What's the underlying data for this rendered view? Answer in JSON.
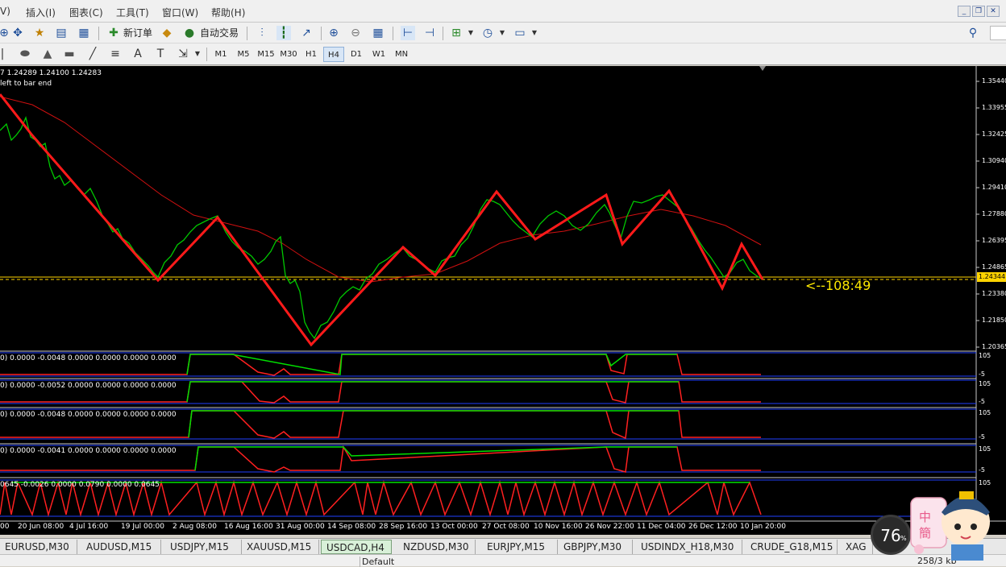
{
  "menu": {
    "items": [
      "V)",
      "插入(I)",
      "图表(C)",
      "工具(T)",
      "窗口(W)",
      "帮助(H)"
    ]
  },
  "toolbar": {
    "new_order_label": "新订单",
    "auto_trade_label": "自动交易"
  },
  "timeframes": [
    {
      "label": "M1",
      "active": false
    },
    {
      "label": "M5",
      "active": false
    },
    {
      "label": "M15",
      "active": false
    },
    {
      "label": "M30",
      "active": false
    },
    {
      "label": "H1",
      "active": false
    },
    {
      "label": "H4",
      "active": true
    },
    {
      "label": "D1",
      "active": false
    },
    {
      "label": "W1",
      "active": false
    },
    {
      "label": "MN",
      "active": false
    }
  ],
  "chart": {
    "ohlc_text": "7 1.24289 1.24100 1.24283",
    "bar_end_text": "left to bar end",
    "timer_text": "<--108:49",
    "bid_price": "1.24344",
    "price_scale": [
      "1.35440",
      "1.33955",
      "1.32425",
      "1.30940",
      "1.29410",
      "1.27880",
      "1.26395",
      "1.24865",
      "1.23380",
      "1.21850",
      "1.20365"
    ],
    "time_scale": [
      "20 Jun 08:00",
      "4 Jul 16:00",
      "19 Jul 00:00",
      "2 Aug 08:00",
      "16 Aug 16:00",
      "31 Aug 00:00",
      "14 Sep 08:00",
      "28 Sep 16:00",
      "13 Oct 00:00",
      "27 Oct 08:00",
      "10 Nov 16:00",
      "26 Nov 22:00",
      "11 Dec 04:00",
      "26 Dec 12:00",
      "10 Jan 20:00"
    ],
    "time_leading": "00",
    "indicators": [
      {
        "label": "0) 0.0000 -0.0048 0.0000 0.0000 0.0000 0.0000",
        "scale_top": "105",
        "scale_bottom": "-5"
      },
      {
        "label": "0) 0.0000 -0.0052 0.0000 0.0000 0.0000 0.0000",
        "scale_top": "105",
        "scale_bottom": "-5"
      },
      {
        "label": "0) 0.0000 -0.0048 0.0000 0.0000 0.0000 0.0000",
        "scale_top": "105",
        "scale_bottom": "-5"
      },
      {
        "label": "0) 0.0000 -0.0041 0.0000 0.0000 0.0000 0.0000",
        "scale_top": "105",
        "scale_bottom": "-5"
      },
      {
        "label": "0645 -0.0026 0.0000 0.0790 0.0000 0.0645",
        "scale_top": "105",
        "scale_bottom": "-5"
      }
    ],
    "colors": {
      "zigzag": "#ff1a1a",
      "candles": "#00c800",
      "ma": "#d01010",
      "bid_line": "#ffd400",
      "timer": "#ffea00",
      "ind_high": "#00e000",
      "ind_low": "#ff2020",
      "ind_axis": "#2040ff"
    }
  },
  "tabs": [
    "EURUSD,M30",
    "AUDUSD,M15",
    "USDJPY,M15",
    "XAUUSD,M15",
    "USDCAD,H4",
    "NZDUSD,M30",
    "EURJPY,M15",
    "GBPJPY,M30",
    "USDINDX_H18,M30",
    "CRUDE_G18,M15",
    "XAG"
  ],
  "active_tab": "USDCAD,H4",
  "status": {
    "profile": "Default",
    "traffic": "258/3 kb"
  },
  "gauge": {
    "value": "76",
    "unit": "%"
  },
  "mascot_text": "中 簡"
}
